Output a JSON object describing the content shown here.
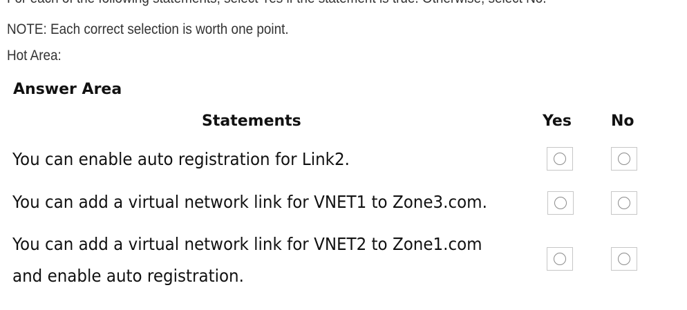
{
  "instructions": [
    "For each of the following statements, select Yes if the statement is true. Otherwise, select No.",
    "NOTE: Each correct selection is worth one point.",
    "Hot Area:"
  ],
  "answer_area": {
    "title": "Answer Area",
    "headers": {
      "statements": "Statements",
      "yes": "Yes",
      "no": "No"
    },
    "statements": [
      {
        "lines": [
          "You can enable auto registration for Link2."
        ]
      },
      {
        "lines": [
          "You can add a virtual network link for VNET1 to Zone3.com."
        ]
      },
      {
        "lines": [
          "You can add a virtual network link for VNET2 to Zone1.com",
          "and enable auto registration."
        ]
      }
    ]
  }
}
